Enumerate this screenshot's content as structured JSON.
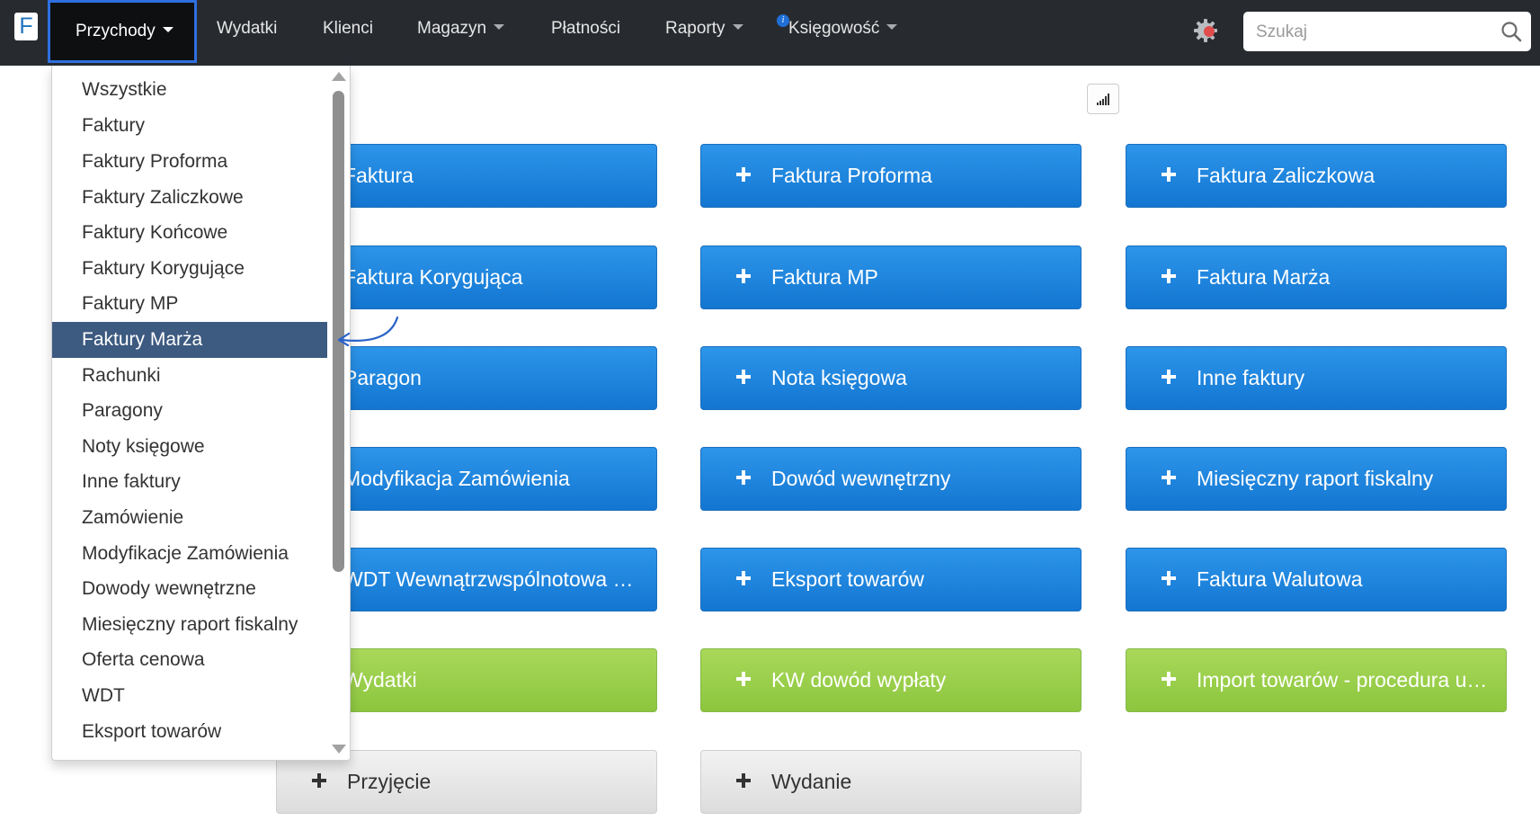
{
  "navbar": {
    "logo": "F",
    "items": [
      {
        "label": "Przychody",
        "dropdown": true,
        "active": true
      },
      {
        "label": "Wydatki",
        "dropdown": false
      },
      {
        "label": "Klienci",
        "dropdown": false
      },
      {
        "label": "Magazyn",
        "dropdown": true
      },
      {
        "label": "Płatności",
        "dropdown": false
      },
      {
        "label": "Raporty",
        "dropdown": true
      },
      {
        "label": "Księgowość",
        "dropdown": true
      }
    ],
    "info_badge": "i",
    "settings_icon": "gear-icon",
    "settings_badge_color": "#e04b4b",
    "search": {
      "placeholder": "Szukaj",
      "value": ""
    }
  },
  "dropdown": {
    "items": [
      "Wszystkie",
      "Faktury",
      "Faktury Proforma",
      "Faktury Zaliczkowe",
      "Faktury Końcowe",
      "Faktury Korygujące",
      "Faktury MP",
      "Faktury Marża",
      "Rachunki",
      "Paragony",
      "Noty księgowe",
      "Inne faktury",
      "Zamówienie",
      "Modyfikacje Zamówienia",
      "Dowody wewnętrzne",
      "Miesięczny raport fiskalny",
      "Oferta cenowa",
      "WDT",
      "Eksport towarów"
    ],
    "selected": "Faktury Marża"
  },
  "tiles": {
    "col1": [
      "Faktura",
      "Faktura Korygująca",
      "Paragon",
      "Modyfikacja Zamówienia",
      "WDT Wewnątrzwspólnotowa …",
      "Wydatki",
      "Przyjęcie"
    ],
    "col2": [
      "Faktura Proforma",
      "Faktura MP",
      "Nota księgowa",
      "Dowód wewnętrzny",
      "Eksport towarów",
      "KW dowód wypłaty",
      "Wydanie"
    ],
    "col3": [
      "Faktura Zaliczkowa",
      "Faktura Marża",
      "Inne faktury",
      "Miesięczny raport fiskalny",
      "Faktura Walutowa",
      "Import towarów - procedura u…"
    ]
  },
  "colors": {
    "navbar": "#272b30",
    "tile_blue": "#1a82dd",
    "tile_green": "#99cf4a",
    "tile_gray": "#e6e6e6",
    "selected_item": "#3d5a80",
    "active_outline": "#2f6fe0"
  }
}
